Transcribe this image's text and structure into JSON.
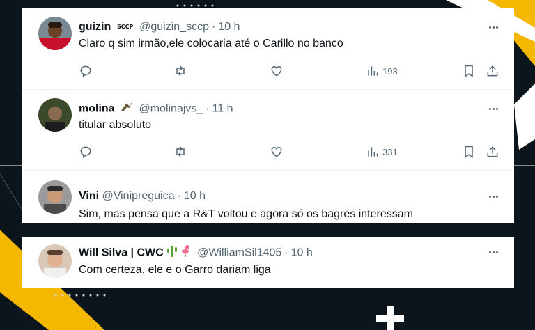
{
  "tweets": [
    {
      "name": "guizin",
      "handle": "@guizin_sccp",
      "time": "10 h",
      "text": "Claro q sim irmão,ele colocaria até o Carillo no banco",
      "views": "193"
    },
    {
      "name": "molina",
      "handle": "@molinajvs_",
      "time": "11 h",
      "text": "titular absoluto",
      "views": "331"
    },
    {
      "name": "Vini",
      "handle": "@Vinipreguica",
      "time": "10 h",
      "text": "Sim, mas pensa que a R&T voltou e agora só os bagres interessam"
    },
    {
      "name": "Will Silva | CWC",
      "handle": "@WilliamSil1405",
      "time": "10 h",
      "text": "Com certeza, ele e o Garro dariam liga"
    }
  ],
  "separator": "·",
  "colors": {
    "accent_yellow": "#f5b800",
    "text": "#0f1419",
    "muted": "#536471"
  },
  "icons": [
    "reply-icon",
    "retweet-icon",
    "like-icon",
    "views-icon",
    "bookmark-icon",
    "share-icon",
    "more-icon"
  ]
}
